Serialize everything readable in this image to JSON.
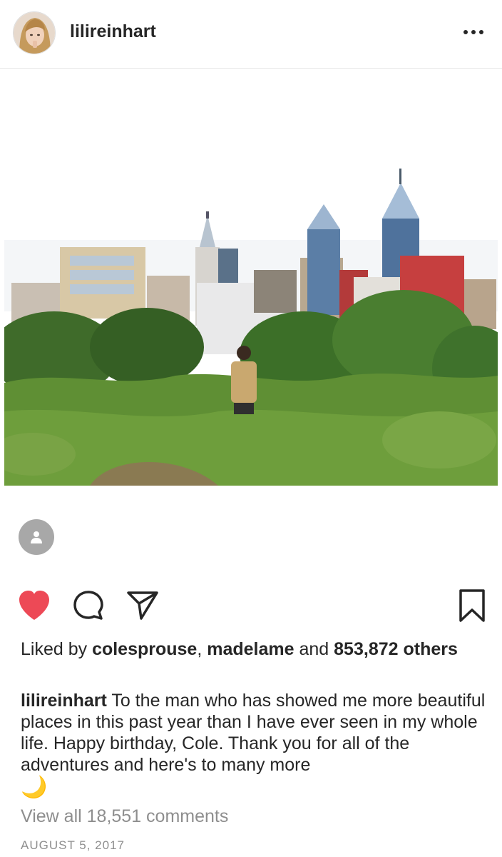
{
  "post": {
    "username": "lilireinhart",
    "more_icon": "more-horizontal-icon",
    "tag_icon": "person-tag-icon"
  },
  "actions": {
    "like_icon": "heart-filled-icon",
    "like_color": "#ed4956",
    "comment_icon": "comment-bubble-icon",
    "share_icon": "paper-plane-icon",
    "save_icon": "bookmark-icon"
  },
  "likes": {
    "prefix": "Liked by ",
    "user1": "colesprouse",
    "separator": ", ",
    "user2": "madelame",
    "and": " and ",
    "count": "853,872 others"
  },
  "caption": {
    "username": "lilireinhart",
    "text": " To the man who has showed me more beautiful places in this past year than I have ever seen in my whole life. Happy birthday, Cole. Thank you for all of the adventures and here's to many more",
    "emoji": "🌙"
  },
  "comments": {
    "view_all_label": "View all 18,551 comments"
  },
  "date": "AUGUST 5, 2017"
}
